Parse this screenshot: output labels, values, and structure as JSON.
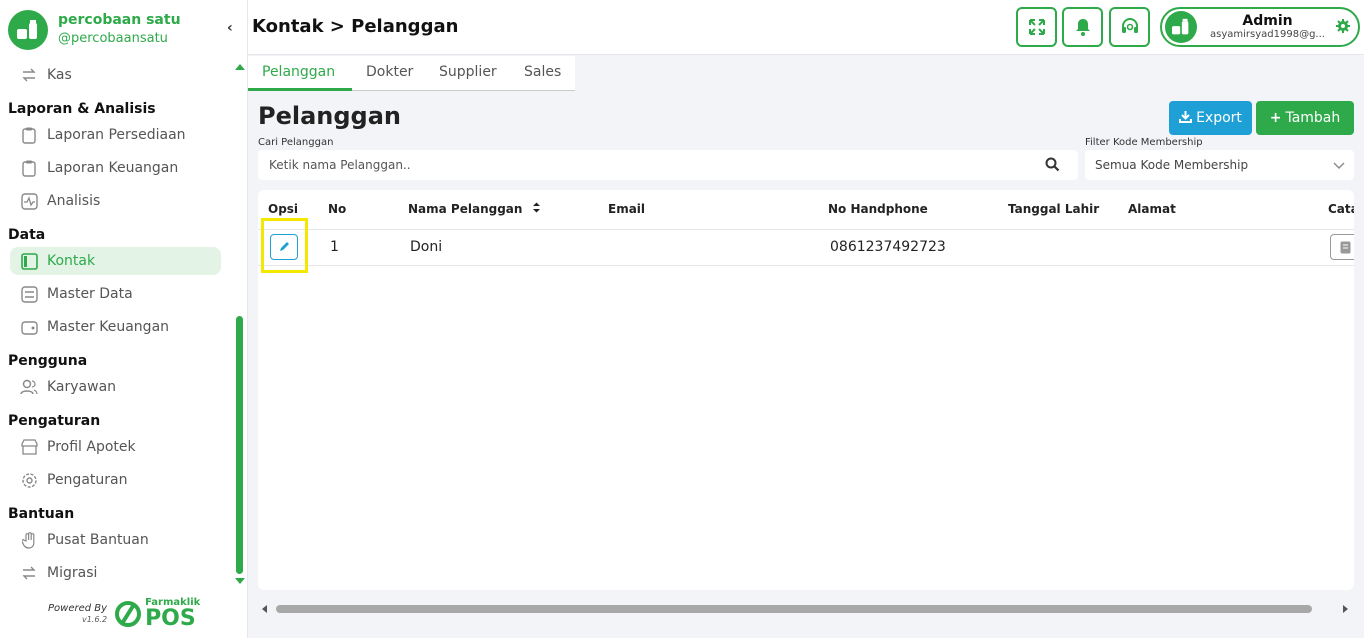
{
  "brand": {
    "name": "percobaan satu",
    "handle": "@percobaansatu"
  },
  "sidebar": {
    "items": [
      {
        "label": "Kas",
        "icon": "exchange-icon"
      },
      {
        "label": "Laporan Persediaan",
        "icon": "clipboard-icon"
      },
      {
        "label": "Laporan Keuangan",
        "icon": "clipboard-icon"
      },
      {
        "label": "Analisis",
        "icon": "pulse-icon"
      },
      {
        "label": "Kontak",
        "icon": "contact-book-icon"
      },
      {
        "label": "Master Data",
        "icon": "database-icon"
      },
      {
        "label": "Master Keuangan",
        "icon": "wallet-icon"
      },
      {
        "label": "Karyawan",
        "icon": "users-icon"
      },
      {
        "label": "Profil Apotek",
        "icon": "store-icon"
      },
      {
        "label": "Pengaturan",
        "icon": "gear-icon"
      },
      {
        "label": "Pusat Bantuan",
        "icon": "hand-icon"
      },
      {
        "label": "Migrasi",
        "icon": "exchange-icon"
      }
    ],
    "sections": [
      "Laporan & Analisis",
      "Data",
      "Pengguna",
      "Pengaturan",
      "Bantuan"
    ],
    "active": "Kontak",
    "accent": "#2eaa4a"
  },
  "footer": {
    "powered_by": "Powered By",
    "version": "v1.6.2",
    "logo_small": "Farmaklik",
    "logo_big": "POS"
  },
  "header": {
    "breadcrumb": "Kontak > Pelanggan",
    "user": {
      "name": "Admin",
      "email": "asyamirsyad1998@g..."
    }
  },
  "tabs": [
    "Pelanggan",
    "Dokter",
    "Supplier",
    "Sales"
  ],
  "main": {
    "title": "Pelanggan",
    "export_label": "Export",
    "tambah_label": "Tambah",
    "search_label": "Cari Pelanggan",
    "search_placeholder": "Ketik nama Pelanggan..",
    "filter_label": "Filter Kode Membership",
    "filter_value": "Semua Kode Membership"
  },
  "table": {
    "columns": [
      "Opsi",
      "No",
      "Nama Pelanggan",
      "Email",
      "No Handphone",
      "Tanggal Lahir",
      "Alamat",
      "Cata"
    ],
    "rows": [
      {
        "no": "1",
        "nama": "Doni",
        "email": "",
        "hp": "0861237492723",
        "tgl": "",
        "alamat": ""
      }
    ]
  },
  "colors": {
    "primary": "#2eaa4a",
    "info": "#1ea0d6",
    "highlight": "#f5e800"
  }
}
